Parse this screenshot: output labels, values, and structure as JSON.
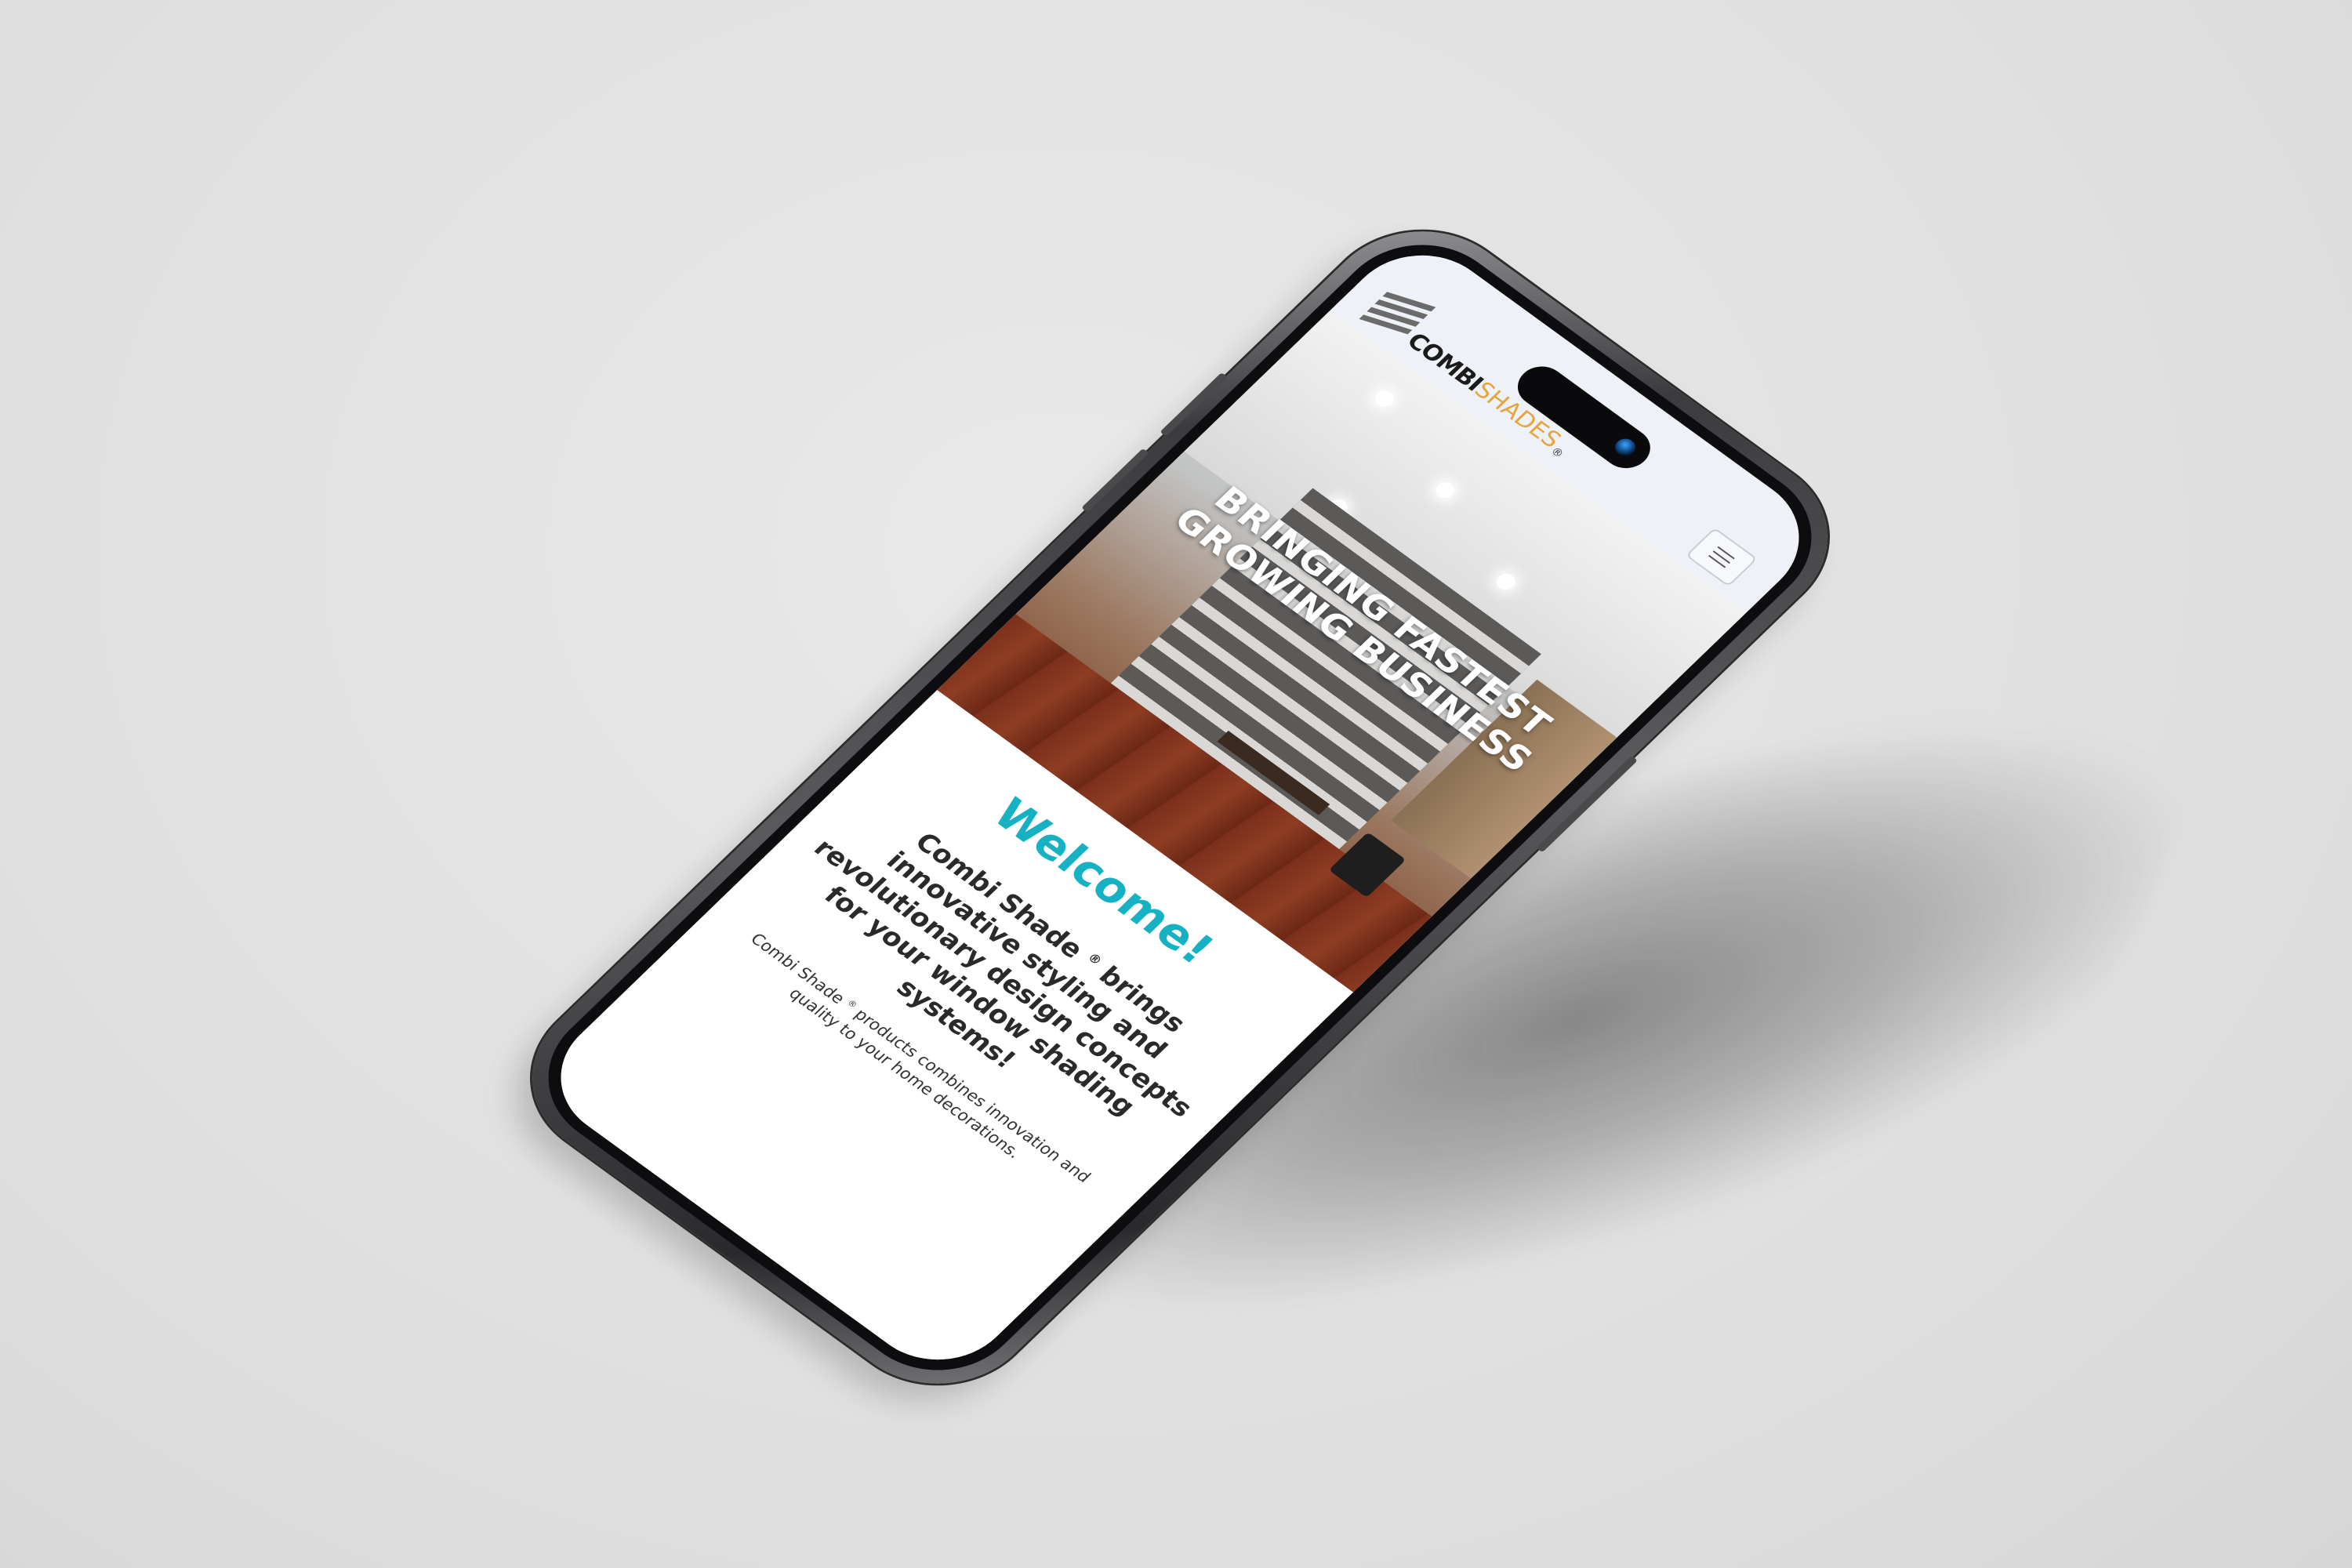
{
  "header": {
    "logo_text_1": "COMBI",
    "logo_text_2": "SHADES",
    "logo_reg": "®",
    "menu_icon": "hamburger-menu-icon"
  },
  "hero": {
    "title": "BRINGING FASTEST GROWING BUSINESS"
  },
  "content": {
    "welcome": "Welcome!",
    "subhead_a": "Combi Shade",
    "subhead_reg": "®",
    "subhead_b": " brings innovative styling and revolutionary design concepts for your window shading systems!",
    "body_a": "Combi Shade",
    "body_reg": "®",
    "body_b": " products combines innovation and quality to your home decorations."
  },
  "colors": {
    "accent": "#16b2c4",
    "logo_orange": "#e6a43a",
    "header_bg": "#eef1f8",
    "background": "#e2e2e2"
  }
}
